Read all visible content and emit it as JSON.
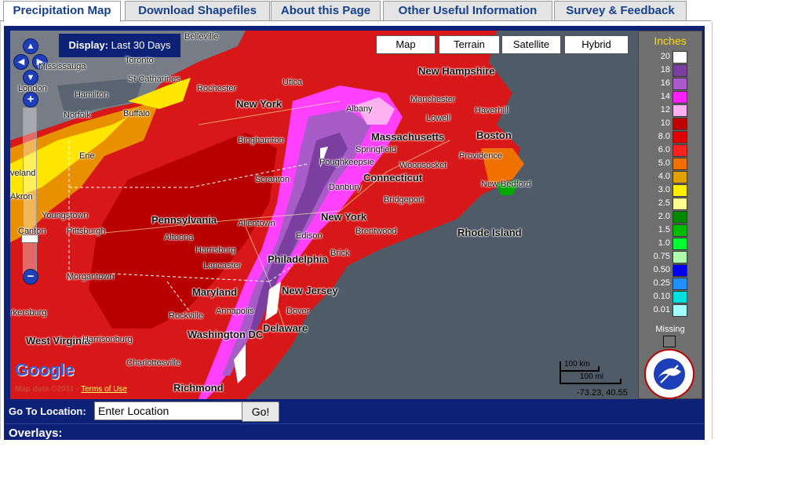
{
  "tabs": [
    {
      "label": "Precipitation Map",
      "active": true
    },
    {
      "label": "Download Shapefiles",
      "active": false
    },
    {
      "label": "About this Page",
      "active": false
    },
    {
      "label": "Other Useful Information",
      "active": false
    },
    {
      "label": "Survey & Feedback",
      "active": false
    }
  ],
  "map": {
    "display_label": "Display:",
    "display_value": "Last 30 Days",
    "map_types": [
      "Map",
      "Terrain",
      "Satellite",
      "Hybrid"
    ],
    "google_logo": "Google",
    "map_data": "Map data ©2011 - ",
    "terms": "Terms of Use",
    "scale_km": "100 km",
    "scale_mi": "100 mi",
    "coords": "-73.23, 40.55",
    "places": {
      "belleville": "Belleville",
      "toronto": "Toronto",
      "mississauga": "Mississauga",
      "st_catharines": "St Catharines",
      "london": "London",
      "hamilton": "Hamilton",
      "rochester": "Rochester",
      "utica": "Utica",
      "new_york_state": "New York",
      "norfolk_on": "Norfolk",
      "buffalo": "Buffalo",
      "erie": "Erie",
      "cleveland": "veland",
      "akron": "Akron",
      "youngstown": "Youngstown",
      "canton": "Canton",
      "pittsburgh": "Pittsburgh",
      "pennsylvania": "Pennsylvania",
      "altoona": "Altoona",
      "harrisburg": "Harrisburg",
      "lancaster": "Lancaster",
      "allentown": "Allentown",
      "scranton": "Scranton",
      "binghamton": "Binghamton",
      "albany": "Albany",
      "springfield": "Springfield",
      "massachusetts": "Massachusetts",
      "new_hampshire": "New Hampshire",
      "manchester": "Manchester",
      "lowell": "Lowell",
      "haverhill": "Haverhill",
      "boston": "Boston",
      "worcester": "Woonsocket",
      "providence": "Providence",
      "new_bedford": "New Bedford",
      "poughkeepsie": "Poughkeepsie",
      "danbury": "Danbury",
      "connecticut": "Connecticut",
      "bridgeport": "Bridgeport",
      "new_york_city": "New York",
      "brentwood": "Brentwood",
      "edison": "Edison",
      "brick": "Brick",
      "philadelphia": "Philadelphia",
      "new_jersey": "New Jersey",
      "dover": "Dover",
      "delaware": "Delaware",
      "maryland": "Maryland",
      "annapolis": "Annapolis",
      "rockville": "Rockville",
      "washington_dc": "Washington DC",
      "morgantown": "Morgantown",
      "west_virginia": "West Virginia",
      "harrisonburg": "Harrisonburg",
      "parkersburg": "rkersburg",
      "charlottesville": "Charlottesville",
      "richmond": "Richmond",
      "rhode_island": "Rhode Island"
    }
  },
  "legend": {
    "title": "Inches",
    "rows": [
      {
        "label": "20",
        "color": "#ffffff"
      },
      {
        "label": "18",
        "color": "#7b3fa0"
      },
      {
        "label": "16",
        "color": "#a95cc9"
      },
      {
        "label": "14",
        "color": "#ff20ff"
      },
      {
        "label": "12",
        "color": "#ffb0f0"
      },
      {
        "label": "10",
        "color": "#c00000"
      },
      {
        "label": "8.0",
        "color": "#e00000"
      },
      {
        "label": "6.0",
        "color": "#ff2020"
      },
      {
        "label": "5.0",
        "color": "#f07000"
      },
      {
        "label": "4.0",
        "color": "#e0a000"
      },
      {
        "label": "3.0",
        "color": "#ffee00"
      },
      {
        "label": "2.5",
        "color": "#ffff90"
      },
      {
        "label": "2.0",
        "color": "#008800"
      },
      {
        "label": "1.5",
        "color": "#00bb00"
      },
      {
        "label": "1.0",
        "color": "#00ff30"
      },
      {
        "label": "0.75",
        "color": "#b0ffb0"
      },
      {
        "label": "0.50",
        "color": "#0000ee"
      },
      {
        "label": "0.25",
        "color": "#2090ff"
      },
      {
        "label": "0.10",
        "color": "#00e0e0"
      },
      {
        "label": "0.01",
        "color": "#a0ffff"
      }
    ],
    "missing": "Missing"
  },
  "goto": {
    "label": "Go To Location:",
    "input_value": "Enter Location",
    "button": "Go!"
  },
  "overlays_label": "Overlays:"
}
